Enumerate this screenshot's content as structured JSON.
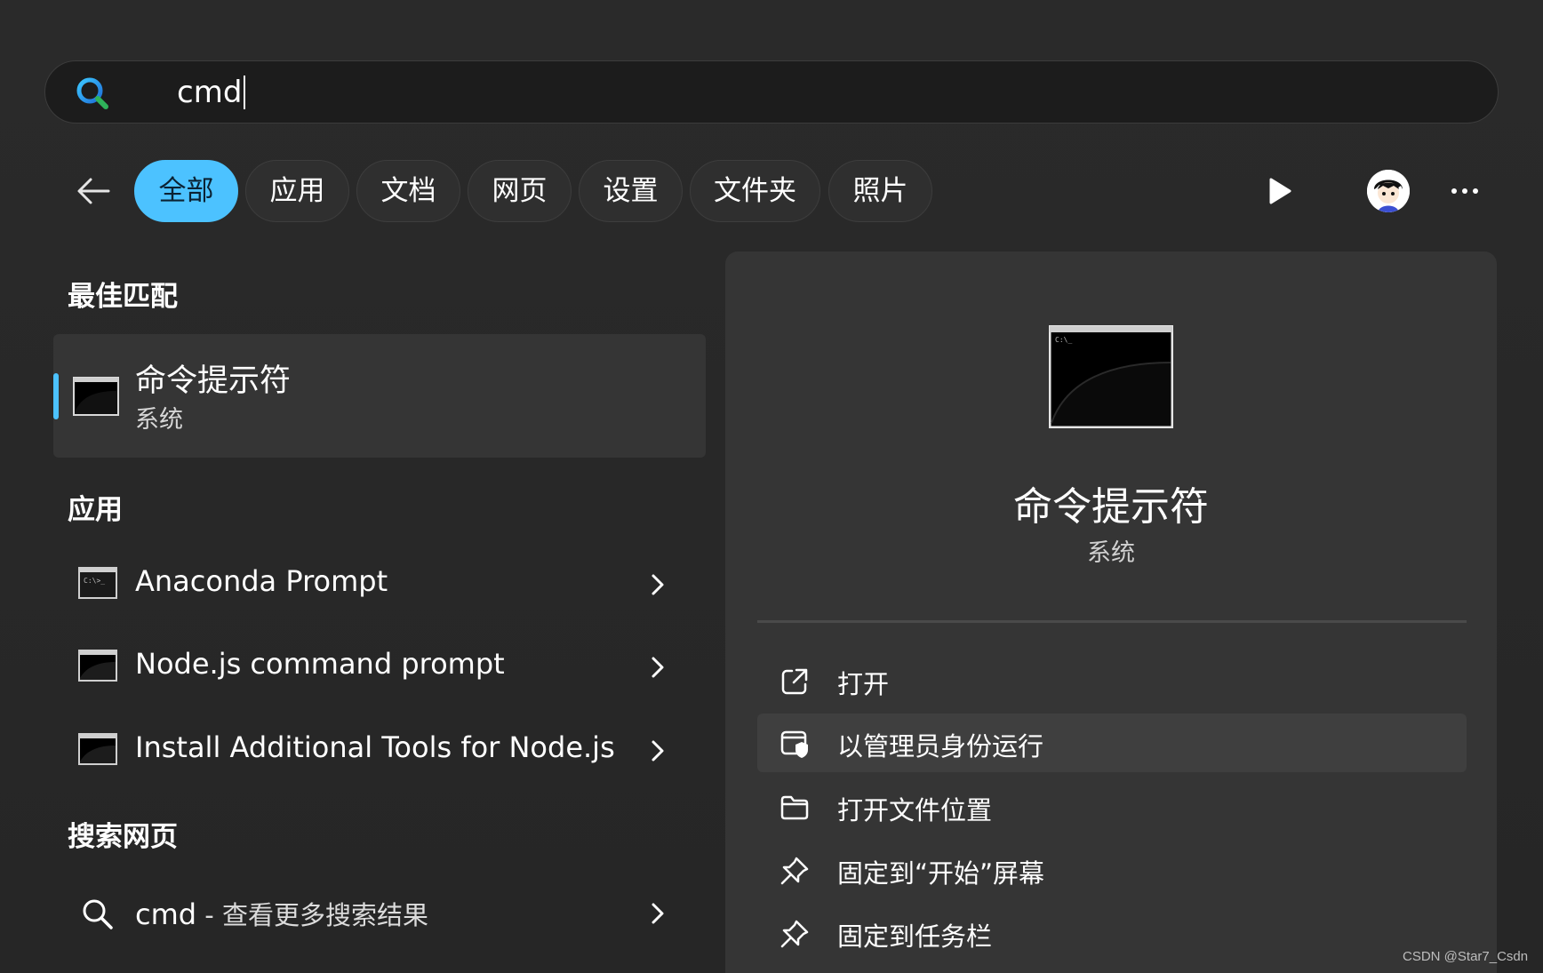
{
  "search": {
    "query": "cmd"
  },
  "filters": [
    "全部",
    "应用",
    "文档",
    "网页",
    "设置",
    "文件夹",
    "照片"
  ],
  "active_filter": "全部",
  "best_match": {
    "section_label": "最佳匹配",
    "name": "命令提示符",
    "category": "系统"
  },
  "apps": {
    "section_label": "应用",
    "items": [
      {
        "label": "Anaconda Prompt"
      },
      {
        "label": "Node.js command prompt"
      },
      {
        "label": "Install Additional Tools for Node.js"
      }
    ]
  },
  "web": {
    "section_label": "搜索网页",
    "query": "cmd",
    "suffix": " - 查看更多搜索结果"
  },
  "detail": {
    "title": "命令提示符",
    "subtitle": "系统",
    "actions": [
      {
        "label": "打开",
        "icon": "open-external-icon"
      },
      {
        "label": "以管理员身份运行",
        "icon": "admin-shield-icon",
        "highlighted": true
      },
      {
        "label": "打开文件位置",
        "icon": "folder-icon"
      },
      {
        "label": "固定到“开始”屏幕",
        "icon": "pin-icon"
      },
      {
        "label": "固定到任务栏",
        "icon": "pin-icon"
      }
    ]
  },
  "watermark": "CSDN @Star7_Csdn",
  "colors": {
    "accent": "#4cc2ff",
    "background": "#262626",
    "panel": "#353535"
  }
}
